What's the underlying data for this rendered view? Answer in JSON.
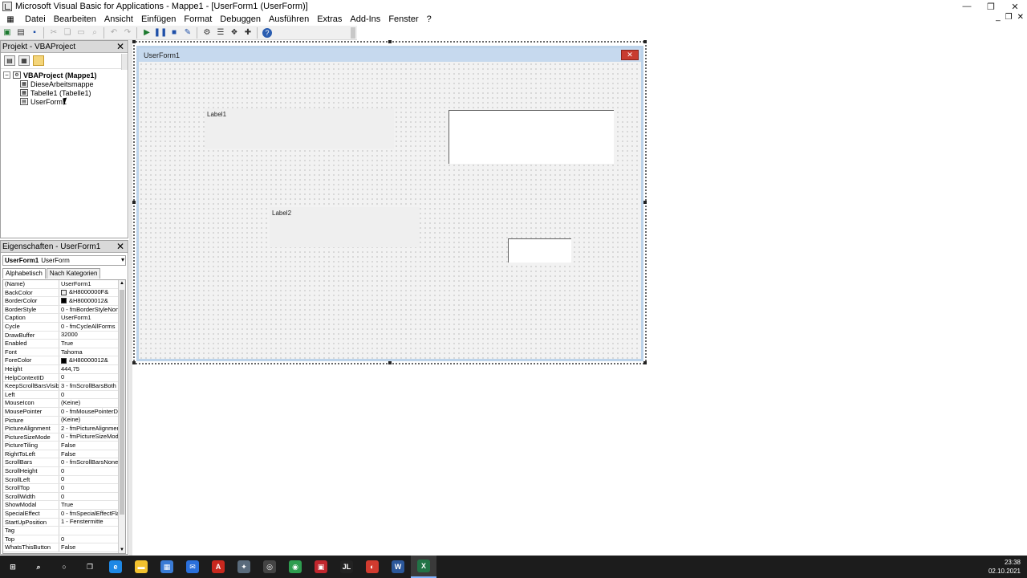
{
  "window": {
    "title": "Microsoft Visual Basic for Applications - Mappe1 - [UserForm1 (UserForm)]",
    "minimize_glyph": "—",
    "restore_glyph": "❐",
    "close_glyph": "✕"
  },
  "menu": {
    "items": [
      "Datei",
      "Bearbeiten",
      "Ansicht",
      "Einfügen",
      "Format",
      "Debuggen",
      "Ausführen",
      "Extras",
      "Add-Ins",
      "Fenster",
      "?"
    ],
    "mdi_minimize": "_",
    "mdi_restore": "❐",
    "mdi_close": "✕"
  },
  "project_panel": {
    "title": "Projekt - VBAProject",
    "close": "✕",
    "tree": {
      "root": "VBAProject (Mappe1)",
      "items": [
        "DieseArbeitsmappe",
        "Tabelle1 (Tabelle1)",
        "UserForm1"
      ]
    }
  },
  "properties_panel": {
    "title": "Eigenschaften - UserForm1",
    "close": "✕",
    "object_name": "UserForm1",
    "object_type": "UserForm",
    "tabs": [
      "Alphabetisch",
      "Nach Kategorien"
    ],
    "rows": [
      {
        "name": "(Name)",
        "value": "UserForm1"
      },
      {
        "name": "BackColor",
        "value": "&H8000000F&",
        "swatch": "#f0f0f0"
      },
      {
        "name": "BorderColor",
        "value": "&H80000012&",
        "swatch": "#000000"
      },
      {
        "name": "BorderStyle",
        "value": "0 - fmBorderStyleNon"
      },
      {
        "name": "Caption",
        "value": "UserForm1"
      },
      {
        "name": "Cycle",
        "value": "0 - fmCycleAllForms"
      },
      {
        "name": "DrawBuffer",
        "value": "32000"
      },
      {
        "name": "Enabled",
        "value": "True"
      },
      {
        "name": "Font",
        "value": "Tahoma"
      },
      {
        "name": "ForeColor",
        "value": "&H80000012&",
        "swatch": "#000000"
      },
      {
        "name": "Height",
        "value": "444,75"
      },
      {
        "name": "HelpContextID",
        "value": "0"
      },
      {
        "name": "KeepScrollBarsVisible",
        "value": "3 - fmScrollBarsBoth"
      },
      {
        "name": "Left",
        "value": "0"
      },
      {
        "name": "MouseIcon",
        "value": "(Keine)"
      },
      {
        "name": "MousePointer",
        "value": "0 - fmMousePointerDe"
      },
      {
        "name": "Picture",
        "value": "(Keine)"
      },
      {
        "name": "PictureAlignment",
        "value": "2 - fmPictureAlignmen"
      },
      {
        "name": "PictureSizeMode",
        "value": "0 - fmPictureSizeMode"
      },
      {
        "name": "PictureTiling",
        "value": "False"
      },
      {
        "name": "RightToLeft",
        "value": "False"
      },
      {
        "name": "ScrollBars",
        "value": "0 - fmScrollBarsNone"
      },
      {
        "name": "ScrollHeight",
        "value": "0"
      },
      {
        "name": "ScrollLeft",
        "value": "0"
      },
      {
        "name": "ScrollTop",
        "value": "0"
      },
      {
        "name": "ScrollWidth",
        "value": "0"
      },
      {
        "name": "ShowModal",
        "value": "True"
      },
      {
        "name": "SpecialEffect",
        "value": "0 - fmSpecialEffectFla"
      },
      {
        "name": "StartUpPosition",
        "value": "1 - Fenstermitte"
      },
      {
        "name": "Tag",
        "value": ""
      },
      {
        "name": "Top",
        "value": "0"
      },
      {
        "name": "WhatsThisButton",
        "value": "False"
      }
    ]
  },
  "userform": {
    "caption": "UserForm1",
    "close_glyph": "✕",
    "label1": "Label1",
    "label2": "Label2"
  },
  "taskbar": {
    "time": "23:38",
    "date": "02.10.2021",
    "apps": [
      {
        "name": "start",
        "glyph": "⊞",
        "color": "#1c1c1c"
      },
      {
        "name": "search",
        "glyph": "⌕",
        "color": "#1c1c1c"
      },
      {
        "name": "cortana",
        "glyph": "○",
        "color": "#1c1c1c"
      },
      {
        "name": "task-view",
        "glyph": "❐",
        "color": "#1c1c1c"
      },
      {
        "name": "edge",
        "glyph": "e",
        "color": "#1e88e5"
      },
      {
        "name": "file-explorer",
        "glyph": "▬",
        "color": "#f2c12e"
      },
      {
        "name": "store",
        "glyph": "▦",
        "color": "#3a7bd5"
      },
      {
        "name": "mail",
        "glyph": "✉",
        "color": "#2a6fdb"
      },
      {
        "name": "acrobat",
        "glyph": "A",
        "color": "#c8281e"
      },
      {
        "name": "app-bird",
        "glyph": "✦",
        "color": "#5a6b7c"
      },
      {
        "name": "app-circle",
        "glyph": "◎",
        "color": "#444444"
      },
      {
        "name": "chrome",
        "glyph": "◉",
        "color": "#2e9d4f"
      },
      {
        "name": "app-red",
        "glyph": "▣",
        "color": "#c0262d"
      },
      {
        "name": "app-jl",
        "glyph": "JL",
        "color": "#222222"
      },
      {
        "name": "app-recorder",
        "glyph": "◐",
        "color": "#d13b2f"
      },
      {
        "name": "word",
        "glyph": "W",
        "color": "#2b579a"
      },
      {
        "name": "excel",
        "glyph": "X",
        "color": "#217346"
      }
    ]
  }
}
